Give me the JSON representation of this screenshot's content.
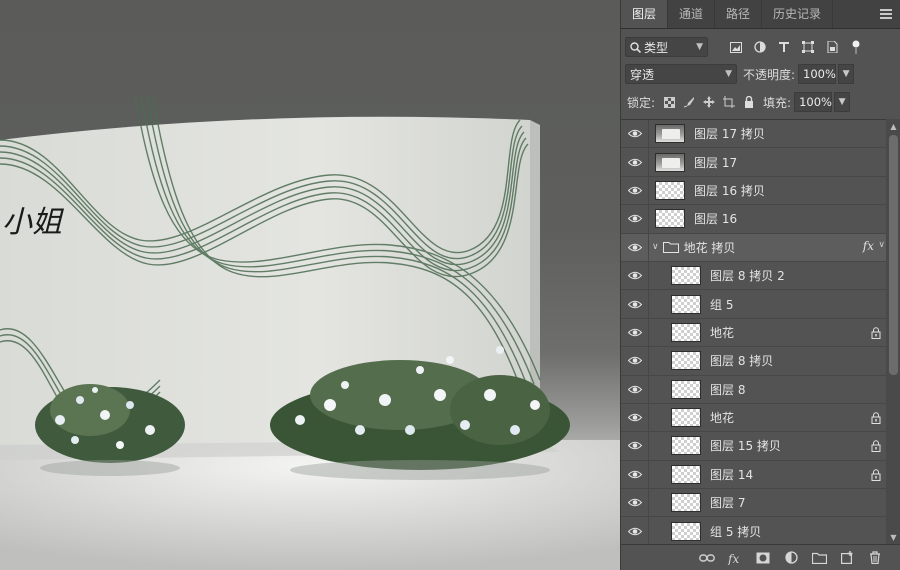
{
  "canvas": {
    "artwork_text": "小姐"
  },
  "panel": {
    "tabs": [
      "图层",
      "通道",
      "路径",
      "历史记录"
    ],
    "active_tab": "图层",
    "filter": {
      "kind_label": "类型"
    },
    "blend": {
      "mode": "穿透",
      "opacity_label": "不透明度:",
      "opacity_value": "100%"
    },
    "lock": {
      "label": "锁定:",
      "fill_label": "填充:",
      "fill_value": "100%"
    },
    "layers": [
      {
        "name": "图层 17 拷贝",
        "thumb": "image",
        "locked": false,
        "indent": false
      },
      {
        "name": "图层 17",
        "thumb": "image",
        "locked": false,
        "indent": false
      },
      {
        "name": "图层 16 拷贝",
        "thumb": "transparent",
        "locked": false,
        "indent": false
      },
      {
        "name": "图层 16",
        "thumb": "transparent",
        "locked": false,
        "indent": false
      },
      {
        "name": "地花 拷贝",
        "type": "group",
        "fx": "fx"
      },
      {
        "name": "图层 8 拷贝 2",
        "thumb": "transparent",
        "locked": false,
        "indent": true
      },
      {
        "name": "组 5",
        "thumb": "transparent",
        "locked": false,
        "indent": true
      },
      {
        "name": "地花",
        "thumb": "transparent",
        "locked": true,
        "indent": true
      },
      {
        "name": "图层 8 拷贝",
        "thumb": "transparent",
        "locked": false,
        "indent": true
      },
      {
        "name": "图层 8",
        "thumb": "transparent",
        "locked": false,
        "indent": true
      },
      {
        "name": "地花",
        "thumb": "transparent",
        "locked": true,
        "indent": true
      },
      {
        "name": "图层 15 拷贝",
        "thumb": "transparent",
        "locked": true,
        "indent": true
      },
      {
        "name": "图层 14",
        "thumb": "transparent",
        "locked": true,
        "indent": true
      },
      {
        "name": "图层 7",
        "thumb": "transparent",
        "locked": false,
        "indent": true
      },
      {
        "name": "组 5 拷贝",
        "thumb": "transparent",
        "locked": false,
        "indent": true
      }
    ],
    "footer_icons": [
      "link-icon",
      "fx-icon",
      "mask-icon",
      "adjustment-icon",
      "folder-icon",
      "new-layer-icon",
      "trash-icon"
    ]
  }
}
